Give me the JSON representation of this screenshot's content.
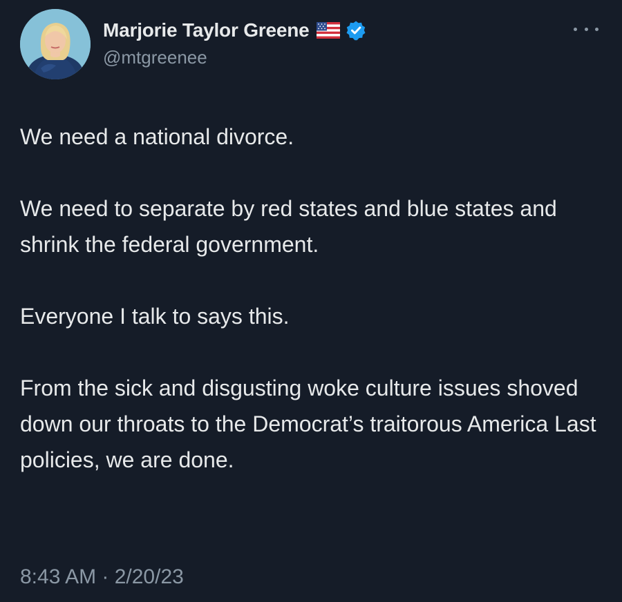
{
  "author": {
    "display_name": "Marjorie Taylor Greene",
    "handle": "@mtgreenee",
    "avatar_icon": "profile-photo",
    "flag_icon": "us-flag-icon",
    "verified_icon": "verified-badge-icon",
    "verified_color": "#1d9bf0"
  },
  "tweet": {
    "paragraphs": [
      "We need a national divorce.",
      "We need to separate by red states and blue states and shrink the federal government.",
      "Everyone I talk to says this.",
      "From the sick and disgusting woke culture issues shoved down our throats to the Democrat’s traitorous America Last policies, we are done."
    ],
    "timestamp": "8:43 AM · 2/20/23"
  },
  "more_button_icon": "more-options-icon",
  "colors": {
    "background": "#151c28",
    "text_primary": "#e7e9ea",
    "text_secondary": "#8b98a5"
  }
}
